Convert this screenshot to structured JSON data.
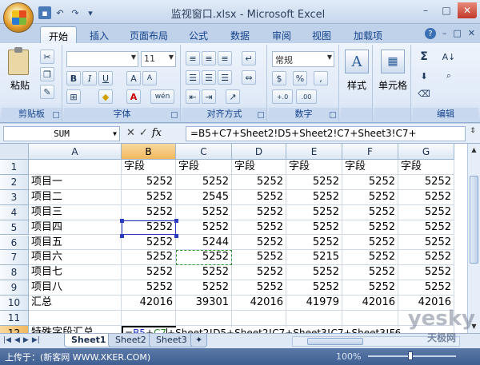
{
  "window": {
    "title": "监视窗口.xlsx - Microsoft Excel",
    "minimize": "–",
    "maximize": "□",
    "close": "✕"
  },
  "qat": {
    "save": "▪",
    "undo": "↶",
    "redo": "↷",
    "custom": "▾"
  },
  "ribbon": {
    "tabs": [
      "开始",
      "插入",
      "页面布局",
      "公式",
      "数据",
      "审阅",
      "视图",
      "加载项"
    ],
    "active_tab": "开始",
    "help": "?",
    "groups": {
      "clipboard": {
        "label": "剪贴板",
        "paste": "粘贴"
      },
      "font": {
        "label": "字体",
        "font_name": "",
        "font_size": "11",
        "bold": "B",
        "italic": "I",
        "underline": "U",
        "grow": "A",
        "shrink": "A",
        "color": "A",
        "cn": "wén"
      },
      "alignment": {
        "label": "对齐方式"
      },
      "number": {
        "label": "数字",
        "format": "常规",
        "currency": "$",
        "percent": "%",
        "comma": ",",
        "inc": "+.0",
        "dec": ".00"
      },
      "styles": {
        "label": "",
        "button": "样式"
      },
      "cells": {
        "label": "",
        "button": "单元格"
      },
      "editing": {
        "label": "编辑",
        "sum": "Σ",
        "sort": "A↓",
        "find": "⌕"
      }
    }
  },
  "formula_bar": {
    "name_box": "SUM",
    "cancel": "✕",
    "enter": "✓",
    "fx": "fx",
    "formula": "=B5+C7+Sheet2!D5+Sheet2!C7+Sheet3!C7+"
  },
  "grid": {
    "columns": [
      "A",
      "B",
      "C",
      "D",
      "E",
      "F",
      "G"
    ],
    "selected_column": "B",
    "rows": [
      {
        "num": "1",
        "cells": [
          "",
          "字段",
          "字段",
          "字段",
          "字段",
          "字段",
          "字段"
        ]
      },
      {
        "num": "2",
        "cells": [
          "项目一",
          "5252",
          "5252",
          "5252",
          "5252",
          "5252",
          "5252"
        ]
      },
      {
        "num": "3",
        "cells": [
          "项目二",
          "5252",
          "2545",
          "5252",
          "5252",
          "5252",
          "5252"
        ]
      },
      {
        "num": "4",
        "cells": [
          "项目三",
          "5252",
          "5252",
          "5252",
          "5252",
          "5252",
          "5252"
        ]
      },
      {
        "num": "5",
        "cells": [
          "项目四",
          "5252",
          "5252",
          "5252",
          "5252",
          "5252",
          "5252"
        ]
      },
      {
        "num": "6",
        "cells": [
          "项目五",
          "5252",
          "5244",
          "5252",
          "5252",
          "5252",
          "5252"
        ]
      },
      {
        "num": "7",
        "cells": [
          "项目六",
          "5252",
          "5252",
          "5252",
          "5215",
          "5252",
          "5252"
        ]
      },
      {
        "num": "8",
        "cells": [
          "项目七",
          "5252",
          "5252",
          "5252",
          "5252",
          "5252",
          "5252"
        ]
      },
      {
        "num": "9",
        "cells": [
          "项目八",
          "5252",
          "5252",
          "5252",
          "5252",
          "5252",
          "5252"
        ]
      },
      {
        "num": "10",
        "cells": [
          "汇总",
          "42016",
          "39301",
          "42016",
          "41979",
          "42016",
          "42016"
        ]
      },
      {
        "num": "11",
        "cells": [
          "",
          "",
          "",
          "",
          "",
          "",
          ""
        ]
      },
      {
        "num": "12",
        "cells": [
          "特殊字段汇总",
          "",
          "",
          "",
          "",
          "",
          ""
        ]
      }
    ],
    "selected_row": "12",
    "edit": {
      "prefix": "=",
      "ref1": "B5",
      "plus": "+",
      "ref2": "C7",
      "rest": "+Sheet2!D5+Sheet2!C7+Sheet3!C7+Sheet3!F6"
    }
  },
  "sheets": {
    "tabs": [
      "Sheet1",
      "Sheet2",
      "Sheet3"
    ],
    "active": "Sheet1",
    "new": "✦"
  },
  "status": {
    "text": "上传于：(新客网 WWW.XKER.COM)",
    "zoom": "100%"
  },
  "watermark": {
    "logo": "yesky",
    "site": "天极网"
  }
}
